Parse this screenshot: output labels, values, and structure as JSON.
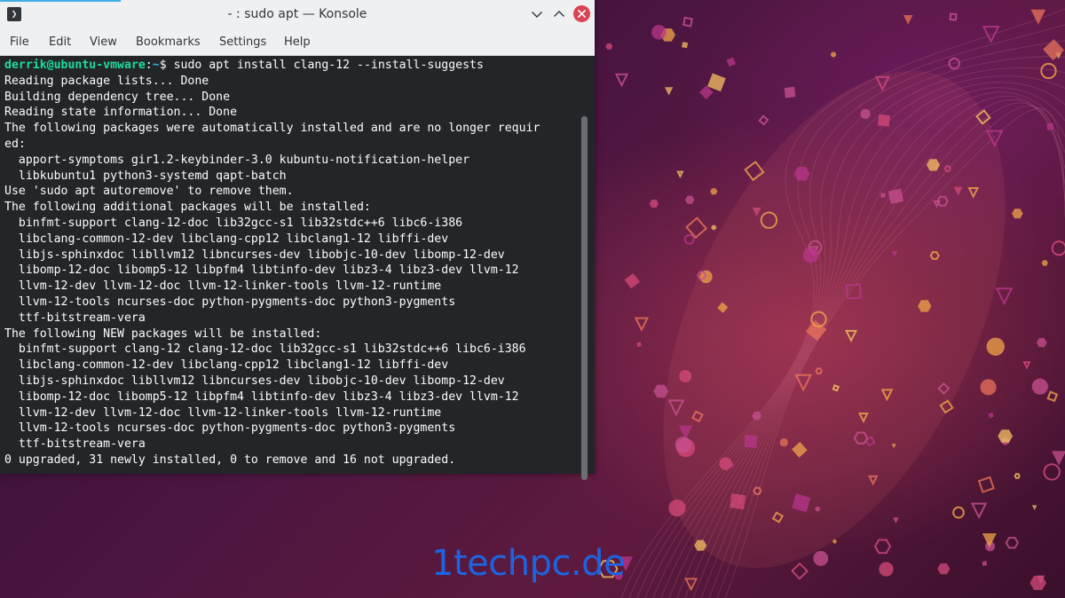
{
  "window": {
    "title": "- : sudo apt — Konsole",
    "app_icon_glyph": "❯",
    "icons": [
      "konsole-app-icon",
      "minimize-icon",
      "maximize-icon",
      "close-icon"
    ]
  },
  "menubar": {
    "items": [
      "File",
      "Edit",
      "View",
      "Bookmarks",
      "Settings",
      "Help"
    ]
  },
  "terminal": {
    "prompt": {
      "user": "derrik@ubuntu-vmware",
      "separator": ":",
      "path": "~",
      "symbol": "$"
    },
    "command": " sudo apt install clang-12 --install-suggests",
    "output": [
      "Reading package lists... Done",
      "Building dependency tree... Done",
      "Reading state information... Done",
      "The following packages were automatically installed and are no longer requir",
      "ed:",
      "  apport-symptoms gir1.2-keybinder-3.0 kubuntu-notification-helper",
      "  libkubuntu1 python3-systemd qapt-batch",
      "Use 'sudo apt autoremove' to remove them.",
      "The following additional packages will be installed:",
      "  binfmt-support clang-12-doc lib32gcc-s1 lib32stdc++6 libc6-i386",
      "  libclang-common-12-dev libclang-cpp12 libclang1-12 libffi-dev",
      "  libjs-sphinxdoc libllvm12 libncurses-dev libobjc-10-dev libomp-12-dev",
      "  libomp-12-doc libomp5-12 libpfm4 libtinfo-dev libz3-4 libz3-dev llvm-12",
      "  llvm-12-dev llvm-12-doc llvm-12-linker-tools llvm-12-runtime",
      "  llvm-12-tools ncurses-doc python-pygments-doc python3-pygments",
      "  ttf-bitstream-vera",
      "The following NEW packages will be installed:",
      "  binfmt-support clang-12 clang-12-doc lib32gcc-s1 lib32stdc++6 libc6-i386",
      "  libclang-common-12-dev libclang-cpp12 libclang1-12 libffi-dev",
      "  libjs-sphinxdoc libllvm12 libncurses-dev libobjc-10-dev libomp-12-dev",
      "  libomp-12-doc libomp5-12 libpfm4 libtinfo-dev libz3-4 libz3-dev llvm-12",
      "  llvm-12-dev llvm-12-doc llvm-12-linker-tools llvm-12-runtime",
      "  llvm-12-tools ncurses-doc python-pygments-doc python3-pygments",
      "  ttf-bitstream-vera",
      "0 upgraded, 31 newly installed, 0 to remove and 16 not upgraded."
    ]
  },
  "watermark": "1techpc.de",
  "colors": {
    "accent": "#3daee9",
    "terminal_bg": "#232629",
    "prompt_user": "#1cdc9a",
    "close_button": "#da4453",
    "watermark": "#1e63e0"
  }
}
